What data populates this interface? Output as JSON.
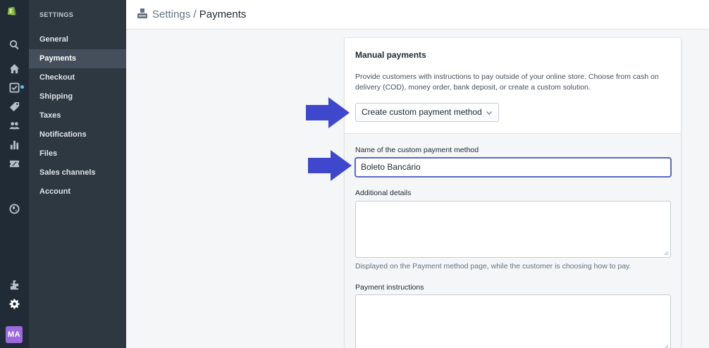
{
  "sidebar": {
    "heading": "SETTINGS",
    "items": [
      {
        "label": "General"
      },
      {
        "label": "Payments",
        "active": true
      },
      {
        "label": "Checkout"
      },
      {
        "label": "Shipping"
      },
      {
        "label": "Taxes"
      },
      {
        "label": "Notifications"
      },
      {
        "label": "Files"
      },
      {
        "label": "Sales channels"
      },
      {
        "label": "Account"
      }
    ]
  },
  "icons": [
    "shopify-logo-icon",
    "search-icon",
    "home-icon",
    "orders-icon",
    "tag-icon",
    "customers-icon",
    "analytics-icon",
    "discounts-icon",
    "globe-icon",
    "apps-icon",
    "gear-icon"
  ],
  "user": {
    "initials": "MA"
  },
  "breadcrumb": {
    "parent": "Settings",
    "separator": " / ",
    "current": "Payments"
  },
  "manual_payments": {
    "title": "Manual payments",
    "description": "Provide customers with instructions to pay outside of your online store. Choose from cash on delivery (COD), money order, bank deposit, or create a custom solution.",
    "select_value": "Create custom payment method"
  },
  "form": {
    "name_label": "Name of the custom payment method",
    "name_value": "Boleto Bancário",
    "details_label": "Additional details",
    "details_help": "Displayed on the Payment method page, while the customer is choosing how to pay.",
    "instructions_label": "Payment instructions"
  },
  "colors": {
    "accent": "#5c6ac4",
    "arrow": "#3f48cc",
    "sidebar": "#212b36"
  }
}
